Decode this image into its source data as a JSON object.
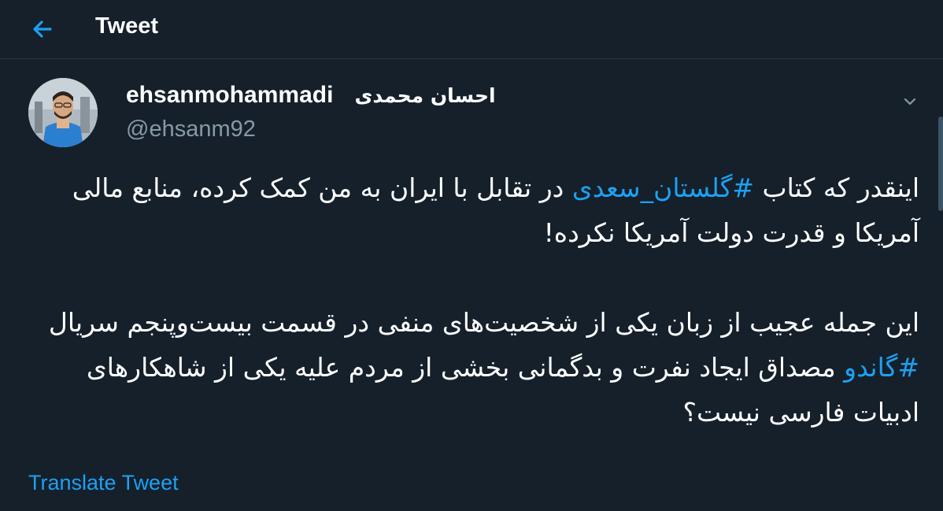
{
  "header": {
    "title": "Tweet",
    "back_icon": "arrow-left-icon"
  },
  "author": {
    "display_name": "ehsanmohammadi",
    "display_name_fa": "احسان محمدی",
    "handle": "@ehsanm92"
  },
  "menu_icon": "chevron-down-icon",
  "tweet": {
    "p1_before": "اینقدر که کتاب ",
    "p1_hashtag": "#گلستان_سعدی",
    "p1_after": " در تقابل با ایران به من کمک کرده، منابع مالی آمریکا و قدرت دولت آمریکا نکرده!",
    "p2_before": "این جمله عجیب از زبان یکی از شخصیت‌های منفی در قسمت بیست‌وپنجم سریال ",
    "p2_hashtag": "#گاندو",
    "p2_after": " مصداق ایجاد نفرت و بدگمانی بخشی از مردم علیه یکی از شاهکارهای ادبیات فارسی نیست؟"
  },
  "translate_label": "Translate Tweet",
  "colors": {
    "background": "#15202b",
    "accent": "#1da1f2",
    "muted": "#8899a6",
    "text": "#ffffff"
  }
}
